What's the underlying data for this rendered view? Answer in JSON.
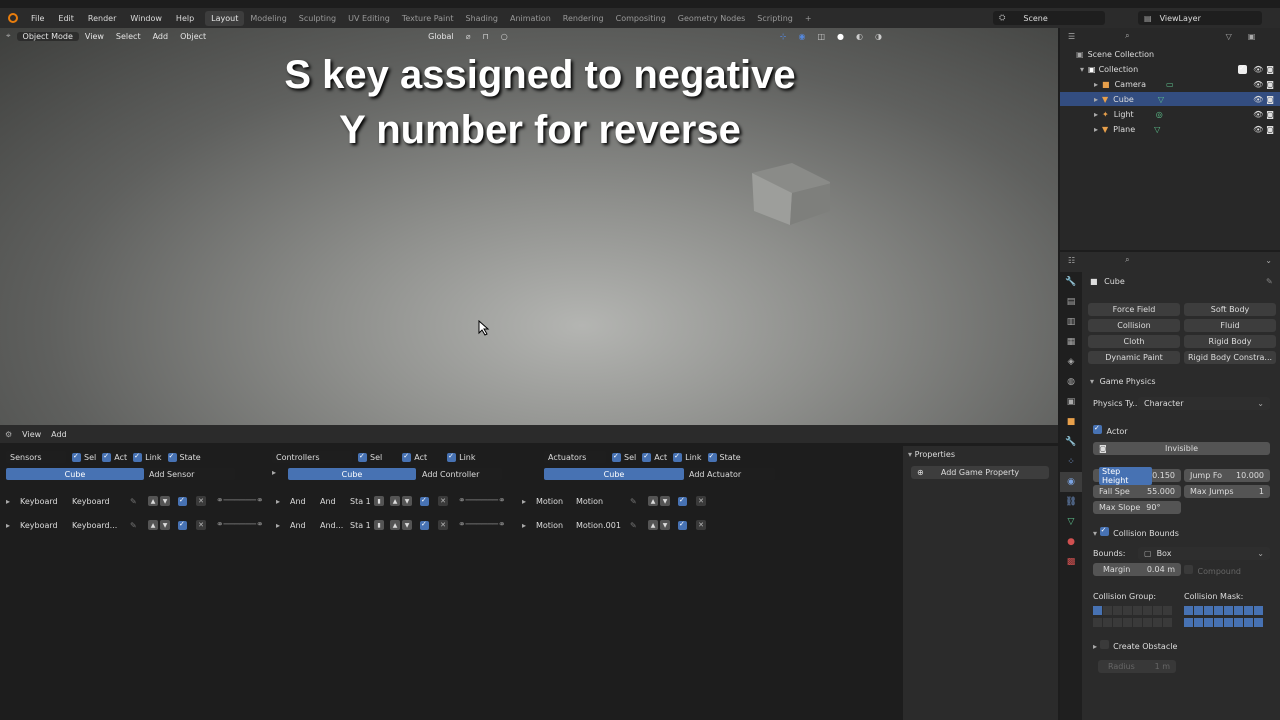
{
  "topbar": {
    "menus": [
      "File",
      "Edit",
      "Render",
      "Window",
      "Help"
    ],
    "workspaces": [
      "Layout",
      "Modeling",
      "Sculpting",
      "UV Editing",
      "Texture Paint",
      "Shading",
      "Animation",
      "Rendering",
      "Compositing",
      "Geometry Nodes",
      "Scripting"
    ],
    "add_tab": "+",
    "scene": "Scene",
    "view_layer": "ViewLayer"
  },
  "viewport": {
    "mode": "Object Mode",
    "menus": [
      "View",
      "Select",
      "Add",
      "Object"
    ],
    "orientation": "Global",
    "overlay_text_line1": "S key assigned to negative",
    "overlay_text_line2": "Y number for reverse"
  },
  "logic": {
    "header_menus": [
      "View",
      "Add"
    ],
    "sensors": {
      "title": "Sensors",
      "checks": [
        "Sel",
        "Act",
        "Link",
        "State"
      ],
      "object": "Cube",
      "add": "Add Sensor",
      "rows": [
        {
          "type": "Keyboard",
          "name": "Keyboard"
        },
        {
          "type": "Keyboard",
          "name": "Keyboard..."
        }
      ]
    },
    "controllers": {
      "title": "Controllers",
      "checks": [
        "Sel",
        "Act",
        "Link"
      ],
      "object": "Cube",
      "add": "Add Controller",
      "rows": [
        {
          "type": "And",
          "name": "And",
          "state": "Sta 1"
        },
        {
          "type": "And",
          "name": "And...",
          "state": "Sta 1"
        }
      ]
    },
    "actuators": {
      "title": "Actuators",
      "checks": [
        "Sel",
        "Act",
        "Link",
        "State"
      ],
      "object": "Cube",
      "add": "Add Actuator",
      "rows": [
        {
          "type": "Motion",
          "name": "Motion"
        },
        {
          "type": "Motion",
          "name": "Motion.001"
        }
      ]
    },
    "properties": {
      "title": "Properties",
      "add": "Add Game Property"
    }
  },
  "outliner": {
    "root": "Scene Collection",
    "items": [
      {
        "label": "Collection"
      },
      {
        "label": "Camera"
      },
      {
        "label": "Cube"
      },
      {
        "label": "Light"
      },
      {
        "label": "Plane"
      }
    ]
  },
  "props": {
    "object_name": "Cube",
    "physics_buttons": [
      "Force Field",
      "Soft Body",
      "Collision",
      "Fluid",
      "Cloth",
      "Rigid Body",
      "Dynamic Paint",
      "Rigid Body Constra..."
    ],
    "game_physics": "Game Physics",
    "physics_type_label": "Physics Ty...",
    "physics_type_value": "Character",
    "actor": "Actor",
    "invisible": "Invisible",
    "step_height": "Step Height",
    "step_height_value": "0.150",
    "jump_force": "Jump Fo",
    "jump_force_value": "10.000",
    "fall_speed": "Fall Spe",
    "fall_speed_value": "55.000",
    "max_jumps": "Max Jumps",
    "max_jumps_value": "1",
    "max_slope": "Max Slope",
    "max_slope_value": "90°",
    "collision_bounds": "Collision Bounds",
    "bounds_label": "Bounds:",
    "bounds_value": "Box",
    "margin_label": "Margin",
    "margin_value": "0.04 m",
    "compound": "Compound",
    "collision_group": "Collision Group:",
    "collision_mask": "Collision Mask:",
    "create_obstacle": "Create Obstacle",
    "radius_label": "Radius",
    "radius_value": "1 m"
  },
  "colors": {
    "accent_blue": "#4772b3",
    "selection": "#334d80",
    "orange": "#e87d0d"
  }
}
